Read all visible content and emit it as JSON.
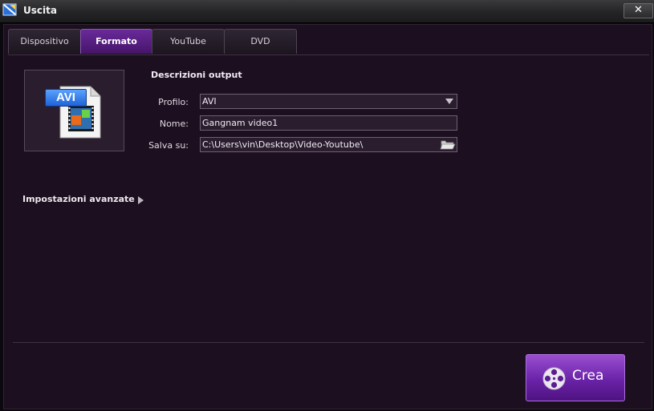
{
  "window": {
    "title": "Uscita",
    "close_label": "✕"
  },
  "tabs": [
    {
      "label": "Dispositivo"
    },
    {
      "label": "Formato"
    },
    {
      "label": "YouTube"
    },
    {
      "label": "DVD"
    }
  ],
  "active_tab": "Formato",
  "format_preview": {
    "badge": "AVI",
    "icon": "avi-file-icon"
  },
  "output": {
    "section_title": "Descrizioni output",
    "profile_label": "Profilo:",
    "profile_value": "AVI",
    "name_label": "Nome:",
    "name_value": "Gangnam video1",
    "save_label": "Salva su:",
    "save_value": "C:\\Users\\vin\\Desktop\\Video-Youtube\\"
  },
  "advanced": {
    "label": "Impostazioni avanzate"
  },
  "create_button": {
    "label": "Crea",
    "icon": "film-reel-icon"
  },
  "colors": {
    "accent": "#6a22a8",
    "background": "#1c0f1f"
  }
}
